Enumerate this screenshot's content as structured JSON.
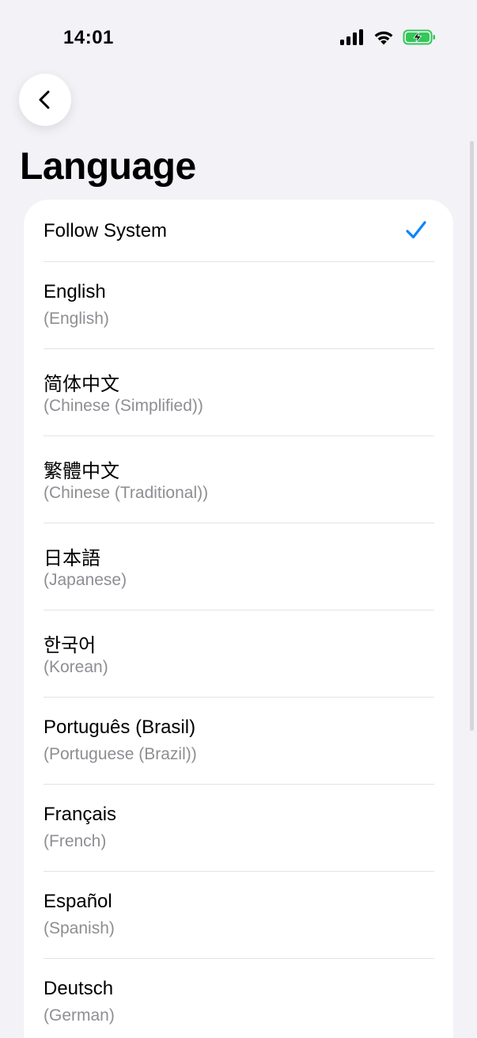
{
  "status_bar": {
    "time": "14:01",
    "icons": [
      "signal-icon",
      "wifi-icon",
      "battery-charging-icon"
    ],
    "battery_color": "#34c759"
  },
  "header": {
    "back_icon": "chevron-left-icon",
    "title": "Language"
  },
  "accent_color": "#0a84ff",
  "languages": [
    {
      "name": "Follow System",
      "sub": "",
      "selected": true
    },
    {
      "name": "English",
      "sub": "(English)",
      "selected": false
    },
    {
      "name": "简体中文",
      "sub": "(Chinese (Simplified))",
      "selected": false
    },
    {
      "name": "繁體中文",
      "sub": "(Chinese (Traditional))",
      "selected": false
    },
    {
      "name": "日本語",
      "sub": "(Japanese)",
      "selected": false
    },
    {
      "name": "한국어",
      "sub": "(Korean)",
      "selected": false
    },
    {
      "name": "Português (Brasil)",
      "sub": "(Portuguese (Brazil))",
      "selected": false
    },
    {
      "name": "Français",
      "sub": "(French)",
      "selected": false
    },
    {
      "name": "Español",
      "sub": "(Spanish)",
      "selected": false
    },
    {
      "name": "Deutsch",
      "sub": "(German)",
      "selected": false
    }
  ]
}
